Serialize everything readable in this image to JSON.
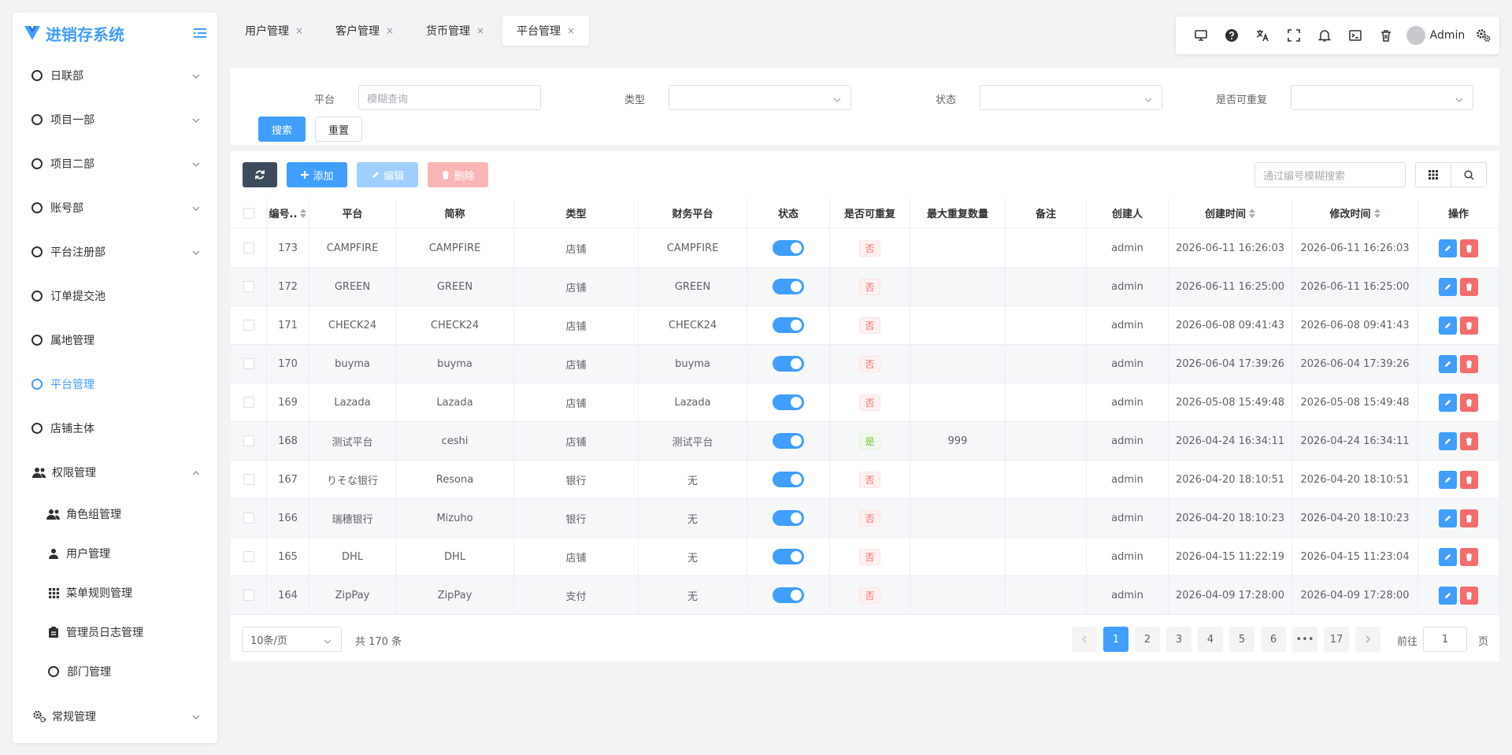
{
  "app": {
    "title": "进销存系统"
  },
  "sidebar": {
    "items": [
      {
        "label": "日联部"
      },
      {
        "label": "项目一部"
      },
      {
        "label": "项目二部"
      },
      {
        "label": "账号部"
      },
      {
        "label": "平台注册部"
      },
      {
        "label": "订单提交池"
      },
      {
        "label": "属地管理"
      },
      {
        "label": "平台管理"
      },
      {
        "label": "店铺主体"
      },
      {
        "label": "权限管理"
      },
      {
        "label": "常规管理"
      }
    ],
    "sub_items": [
      {
        "label": "角色组管理"
      },
      {
        "label": "用户管理"
      },
      {
        "label": "菜单规则管理"
      },
      {
        "label": "管理员日志管理"
      },
      {
        "label": "部门管理"
      }
    ]
  },
  "tabs": [
    {
      "label": "用户管理"
    },
    {
      "label": "客户管理"
    },
    {
      "label": "货币管理"
    },
    {
      "label": "平台管理"
    }
  ],
  "tab_close": "×",
  "user": {
    "name": "Admin"
  },
  "filters": {
    "platform_label": "平台",
    "platform_placeholder": "模糊查询",
    "type_label": "类型",
    "status_label": "状态",
    "repeat_label": "是否可重复",
    "search_btn": "搜索",
    "reset_btn": "重置"
  },
  "actions": {
    "add": "添加",
    "edit": "编辑",
    "delete": "删除",
    "id_search_placeholder": "通过编号模糊搜索"
  },
  "table": {
    "headers": [
      "编号..",
      "平台",
      "简称",
      "类型",
      "财务平台",
      "状态",
      "是否可重复",
      "最大重复数量",
      "备注",
      "创建人",
      "创建时间",
      "修改时间",
      "操作"
    ],
    "rows": [
      {
        "id": "173",
        "platform": "CAMPFIRE",
        "abbr": "CAMPFIRE",
        "type": "店铺",
        "finance": "CAMPFIRE",
        "enabled": true,
        "repeat": "否",
        "max": "",
        "note": "",
        "creator": "admin",
        "created": "2026-06-11 16:26:03",
        "modified": "2026-06-11 16:26:03"
      },
      {
        "id": "172",
        "platform": "GREEN",
        "abbr": "GREEN",
        "type": "店铺",
        "finance": "GREEN",
        "enabled": true,
        "repeat": "否",
        "max": "",
        "note": "",
        "creator": "admin",
        "created": "2026-06-11 16:25:00",
        "modified": "2026-06-11 16:25:00"
      },
      {
        "id": "171",
        "platform": "CHECK24",
        "abbr": "CHECK24",
        "type": "店铺",
        "finance": "CHECK24",
        "enabled": true,
        "repeat": "否",
        "max": "",
        "note": "",
        "creator": "admin",
        "created": "2026-06-08 09:41:43",
        "modified": "2026-06-08 09:41:43"
      },
      {
        "id": "170",
        "platform": "buyma",
        "abbr": "buyma",
        "type": "店铺",
        "finance": "buyma",
        "enabled": true,
        "repeat": "否",
        "max": "",
        "note": "",
        "creator": "admin",
        "created": "2026-06-04 17:39:26",
        "modified": "2026-06-04 17:39:26"
      },
      {
        "id": "169",
        "platform": "Lazada",
        "abbr": "Lazada",
        "type": "店铺",
        "finance": "Lazada",
        "enabled": true,
        "repeat": "否",
        "max": "",
        "note": "",
        "creator": "admin",
        "created": "2026-05-08 15:49:48",
        "modified": "2026-05-08 15:49:48"
      },
      {
        "id": "168",
        "platform": "测试平台",
        "abbr": "ceshi",
        "type": "店铺",
        "finance": "测试平台",
        "enabled": true,
        "repeat": "是",
        "max": "999",
        "note": "",
        "creator": "admin",
        "created": "2026-04-24 16:34:11",
        "modified": "2026-04-24 16:34:11"
      },
      {
        "id": "167",
        "platform": "りそな银行",
        "abbr": "Resona",
        "type": "银行",
        "finance": "无",
        "enabled": true,
        "repeat": "否",
        "max": "",
        "note": "",
        "creator": "admin",
        "created": "2026-04-20 18:10:51",
        "modified": "2026-04-20 18:10:51"
      },
      {
        "id": "166",
        "platform": "瑞穗银行",
        "abbr": "Mizuho",
        "type": "银行",
        "finance": "无",
        "enabled": true,
        "repeat": "否",
        "max": "",
        "note": "",
        "creator": "admin",
        "created": "2026-04-20 18:10:23",
        "modified": "2026-04-20 18:10:23"
      },
      {
        "id": "165",
        "platform": "DHL",
        "abbr": "DHL",
        "type": "店铺",
        "finance": "无",
        "enabled": true,
        "repeat": "否",
        "max": "",
        "note": "",
        "creator": "admin",
        "created": "2026-04-15 11:22:19",
        "modified": "2026-04-15 11:23:04"
      },
      {
        "id": "164",
        "platform": "ZipPay",
        "abbr": "ZipPay",
        "type": "支付",
        "finance": "无",
        "enabled": true,
        "repeat": "否",
        "max": "",
        "note": "",
        "creator": "admin",
        "created": "2026-04-09 17:28:00",
        "modified": "2026-04-09 17:28:00"
      }
    ]
  },
  "pagination": {
    "page_size": "10条/页",
    "total": "共 170 条",
    "pages": [
      "1",
      "2",
      "3",
      "4",
      "5",
      "6",
      "•••",
      "17"
    ],
    "current": "1",
    "goto_label": "前往",
    "goto_value": "1",
    "goto_suffix": "页"
  },
  "colors": {
    "primary": "#409eff",
    "danger": "#f56c6c",
    "success": "#67c23a"
  }
}
